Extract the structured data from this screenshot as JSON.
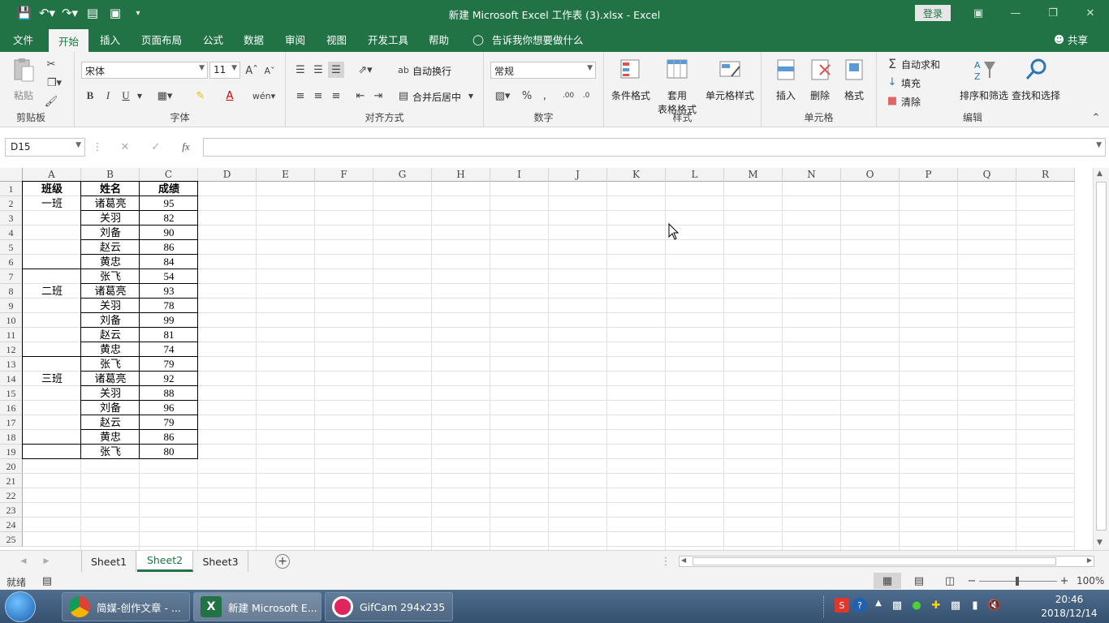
{
  "titlebar": {
    "title": "新建 Microsoft Excel 工作表 (3).xlsx  -  Excel",
    "login": "登录"
  },
  "tabs": [
    "文件",
    "开始",
    "插入",
    "页面布局",
    "公式",
    "数据",
    "审阅",
    "视图",
    "开发工具",
    "帮助"
  ],
  "active_tab": "开始",
  "tell_me": "告诉我你想要做什么",
  "share": "共享",
  "ribbon": {
    "clipboard": {
      "paste": "粘贴",
      "label": "剪贴板"
    },
    "font": {
      "name": "宋体",
      "size": "11",
      "bold": "B",
      "italic": "I",
      "underline": "U",
      "label": "字体"
    },
    "alignment": {
      "wrap": "自动换行",
      "merge": "合并后居中",
      "label": "对齐方式"
    },
    "number": {
      "format": "常规",
      "label": "数字"
    },
    "styles": {
      "conditional": "条件格式",
      "table1": "套用",
      "table2": "表格格式",
      "cell": "单元格样式",
      "label": "样式"
    },
    "cells": {
      "insert": "插入",
      "delete": "删除",
      "format": "格式",
      "label": "单元格"
    },
    "editing": {
      "autosum": "自动求和",
      "fill": "填充",
      "clear": "清除",
      "sort": "排序和筛选",
      "find": "查找和选择",
      "label": "编辑"
    }
  },
  "formula_bar": {
    "name_box": "D15",
    "fx": "fx",
    "content": ""
  },
  "columns": [
    "A",
    "B",
    "C",
    "D",
    "E",
    "F",
    "G",
    "H",
    "I",
    "J",
    "K",
    "L",
    "M",
    "N",
    "O",
    "P",
    "Q",
    "R"
  ],
  "rows": [
    "1",
    "2",
    "3",
    "4",
    "5",
    "6",
    "7",
    "8",
    "9",
    "10",
    "11",
    "12",
    "13",
    "14",
    "15",
    "16",
    "17",
    "18",
    "19",
    "20",
    "21",
    "22",
    "23",
    "24",
    "25"
  ],
  "table": {
    "headers": [
      "班级",
      "姓名",
      "成绩"
    ],
    "rows": [
      [
        "一班",
        "诸葛亮",
        "95"
      ],
      [
        "",
        "关羽",
        "82"
      ],
      [
        "",
        "刘备",
        "90"
      ],
      [
        "",
        "赵云",
        "86"
      ],
      [
        "",
        "黄忠",
        "84"
      ],
      [
        "",
        "张飞",
        "54"
      ],
      [
        "二班",
        "诸葛亮",
        "93"
      ],
      [
        "",
        "关羽",
        "78"
      ],
      [
        "",
        "刘备",
        "99"
      ],
      [
        "",
        "赵云",
        "81"
      ],
      [
        "",
        "黄忠",
        "74"
      ],
      [
        "",
        "张飞",
        "79"
      ],
      [
        "三班",
        "诸葛亮",
        "92"
      ],
      [
        "",
        "关羽",
        "88"
      ],
      [
        "",
        "刘备",
        "96"
      ],
      [
        "",
        "赵云",
        "79"
      ],
      [
        "",
        "黄忠",
        "86"
      ],
      [
        "",
        "张飞",
        "80"
      ]
    ]
  },
  "sheets": [
    "Sheet1",
    "Sheet2",
    "Sheet3"
  ],
  "active_sheet": "Sheet2",
  "status": {
    "ready": "就绪",
    "zoom": "100%"
  },
  "taskbar": {
    "items": [
      "简媒-创作文章 - ...",
      "新建 Microsoft E...",
      "GifCam 294x235"
    ],
    "time": "20:46",
    "date": "2018/12/14"
  },
  "colors": {
    "excel_green": "#217346",
    "ribbon_bg": "#f3f3f3"
  }
}
